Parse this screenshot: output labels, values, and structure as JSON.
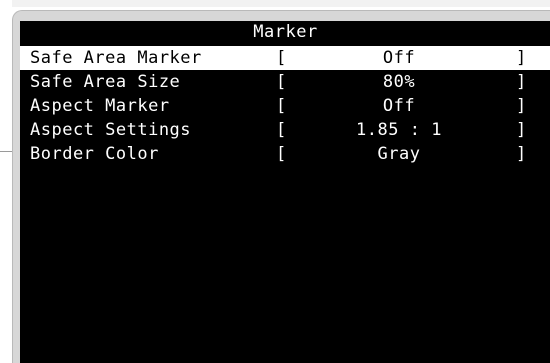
{
  "menu": {
    "title": "Marker",
    "rows": [
      {
        "label": "Safe Area Marker",
        "open": "[",
        "value": "Off",
        "close": "]"
      },
      {
        "label": "Safe Area Size",
        "open": "[",
        "value": "80%",
        "close": "]"
      },
      {
        "label": "Aspect Marker",
        "open": "[",
        "value": "Off",
        "close": "]"
      },
      {
        "label": "Aspect Settings",
        "open": "[",
        "value": "1.85 : 1",
        "close": "]"
      },
      {
        "label": "Border Color",
        "open": "[",
        "value": "Gray",
        "close": "]"
      }
    ],
    "selected_row": "Safe Area Marker"
  },
  "colors": {
    "panel_background": "#000000",
    "frame": "#d7d7d7",
    "text": "#ffffff",
    "selected_background": "#ffffff",
    "selected_text": "#000000"
  }
}
